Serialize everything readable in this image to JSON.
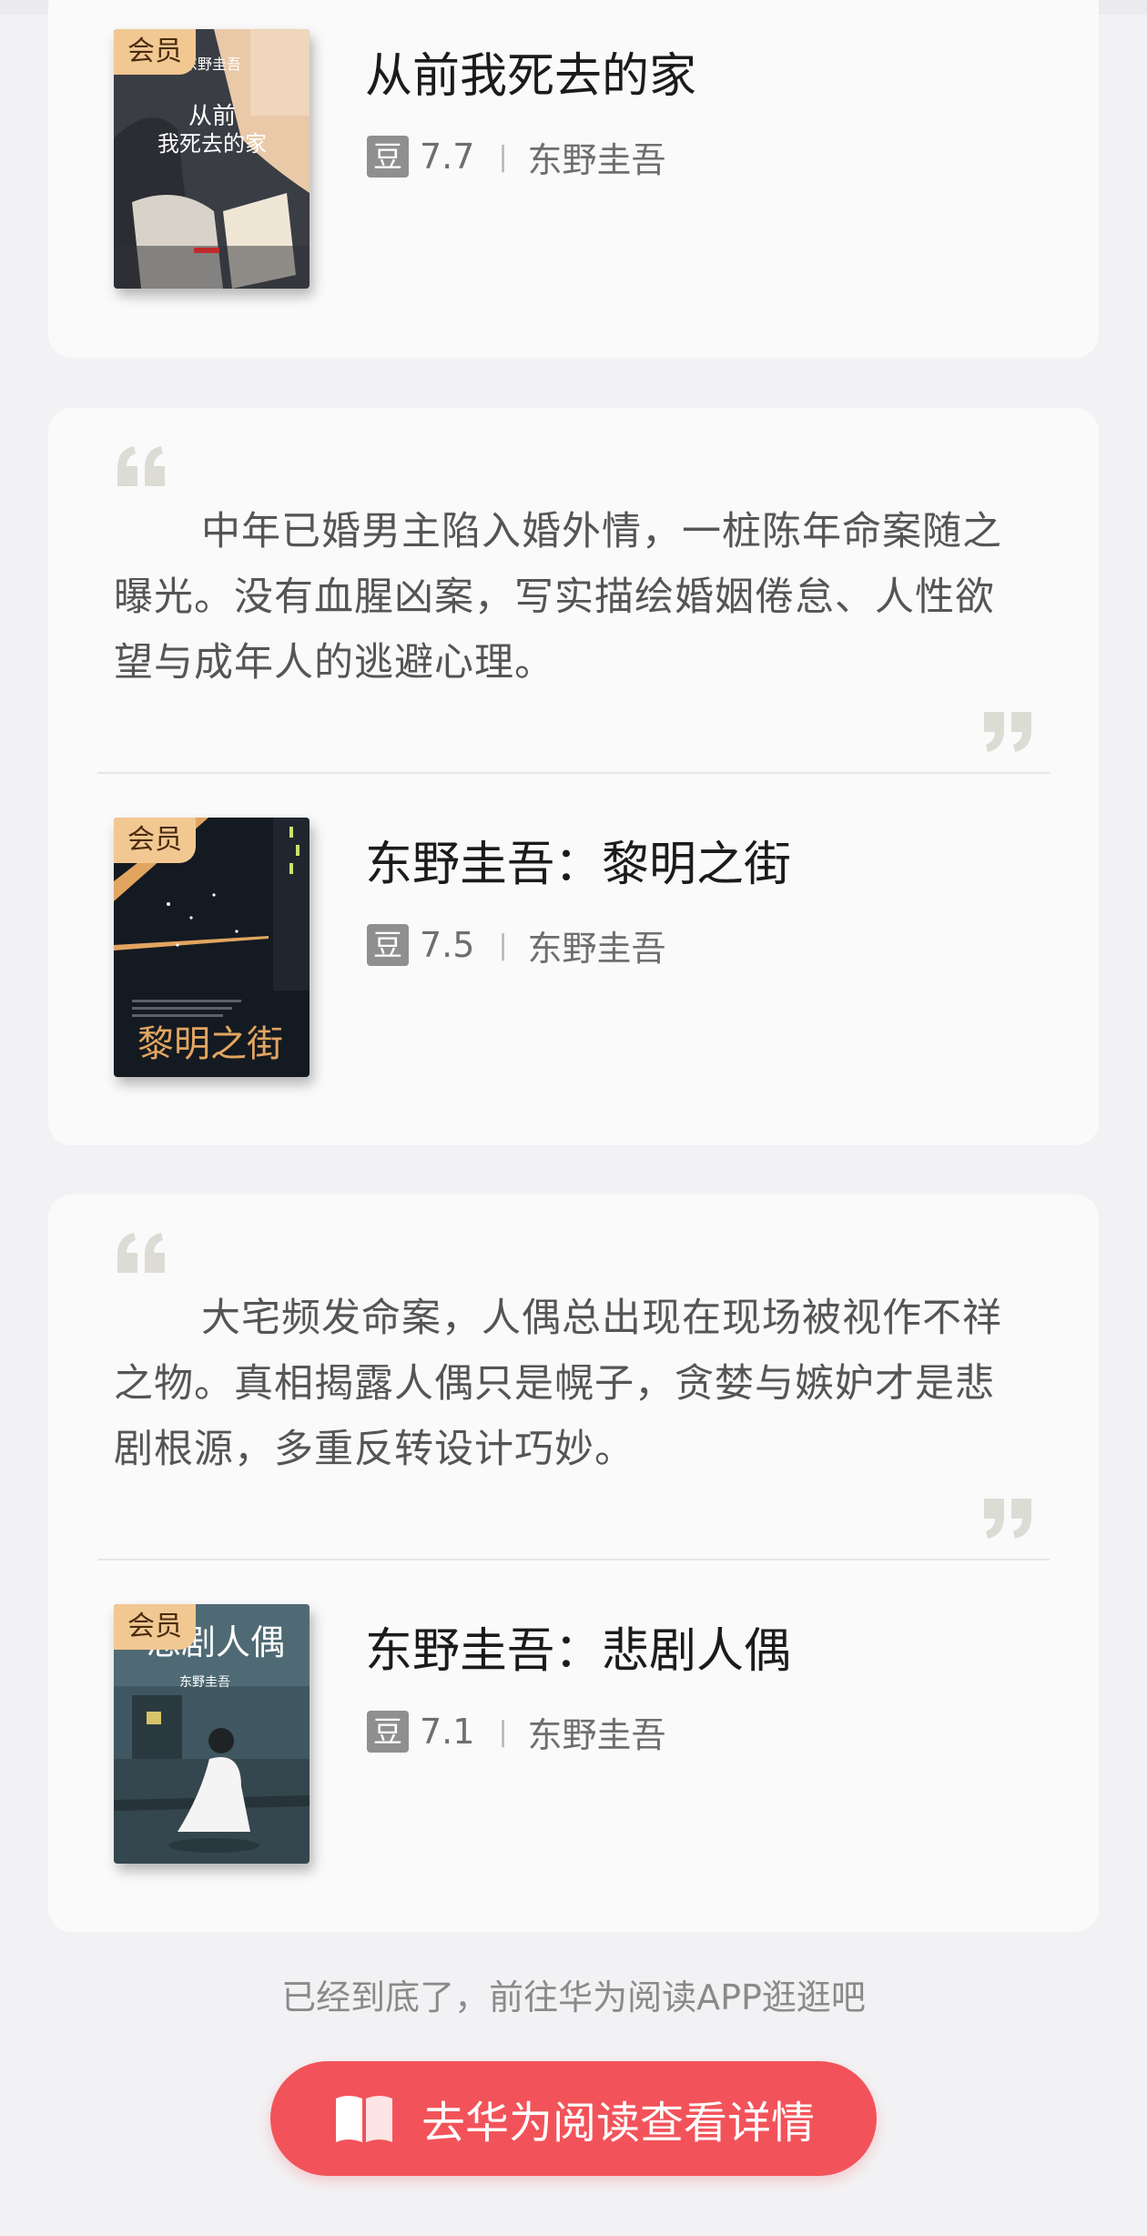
{
  "cards": [
    {
      "book": {
        "badge": "会员",
        "title": "从前我死去的家",
        "rating_icon": "豆",
        "rating": "7.7",
        "separator": "|",
        "author": "东野圭吾",
        "cover_texts": [
          "东野圭吾",
          "从前",
          "我死去的家"
        ]
      }
    },
    {
      "quote": "中年已婚男主陷入婚外情，一桩陈年命案随之曝光。没有血腥凶案，写实描绘婚姻倦怠、人性欲望与成年人的逃避心理。",
      "book": {
        "badge": "会员",
        "title": "东野圭吾：黎明之街",
        "rating_icon": "豆",
        "rating": "7.5",
        "separator": "|",
        "author": "东野圭吾",
        "cover_texts": [
          "黎明之街"
        ]
      }
    },
    {
      "quote": "大宅频发命案，人偶总出现在现场被视作不祥之物。真相揭露人偶只是幌子，贪婪与嫉妒才是悲剧根源，多重反转设计巧妙。",
      "book": {
        "badge": "会员",
        "title": "东野圭吾：悲剧人偶",
        "rating_icon": "豆",
        "rating": "7.1",
        "separator": "|",
        "author": "东野圭吾",
        "cover_texts": [
          "悲剧人偶",
          "东野圭吾"
        ]
      }
    }
  ],
  "footer": {
    "end_text": "已经到底了，前往华为阅读APP逛逛吧",
    "button_label": "去华为阅读查看详情",
    "button_icon": "open-book-icon"
  },
  "colors": {
    "accent": "#f2535a",
    "badge": "#f2c892",
    "card_bg": "#fafafa",
    "page_bg": "#f2f2f4"
  }
}
